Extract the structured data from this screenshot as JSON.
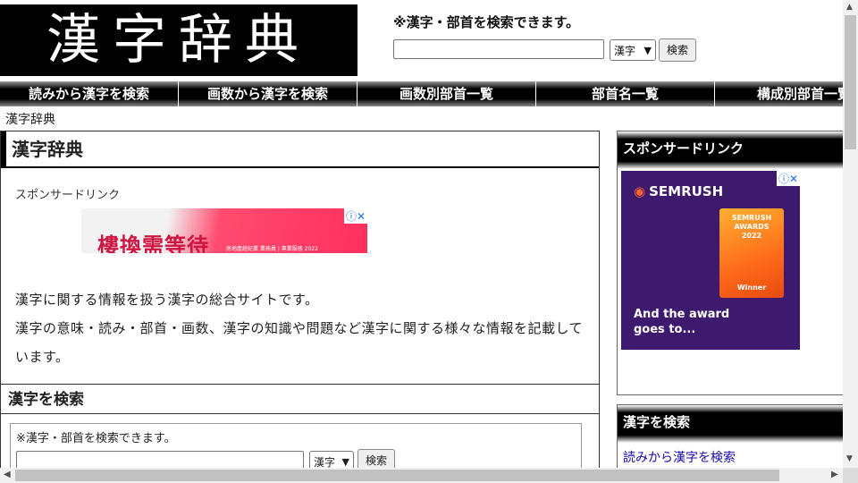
{
  "header": {
    "logo_text": "漢字辞典",
    "search_note": "※漢字・部首を検索できます。",
    "search_select": "漢字",
    "search_button": "検索"
  },
  "nav": {
    "items": [
      "読みから漢字を検索",
      "画数から漢字を検索",
      "画数別部首一覧",
      "部首名一覧",
      "構成別部首一覧"
    ]
  },
  "breadcrumb": "漢字辞典",
  "main": {
    "title": "漢字辞典",
    "sponsor_label": "スポンサードリンク",
    "ad": {
      "text": "樓換需等待",
      "fine_print": "房地產經紀業 業務員 | 專業服務 2022",
      "close_icon": "ⓘ✕"
    },
    "intro": [
      "漢字に関する情報を扱う漢字の総合サイトです。",
      "漢字の意味・読み・部首・画数、漢字の知識や問題など漢字に関する様々な情報を記載しています。"
    ],
    "search_section": {
      "title": "漢字を検索",
      "note": "※漢字・部首を検索できます。",
      "select": "漢字",
      "button": "検索"
    }
  },
  "sidebar": {
    "sponsor": {
      "title": "スポンサードリンク",
      "ad_brand": "SEMRUSH",
      "ad_award": "SEMRUSH AWARDS 2022",
      "ad_award_sub": "Winner",
      "ad_tagline_1": "And the award",
      "ad_tagline_2": "goes to...",
      "close_icon": "ⓘ✕"
    },
    "search": {
      "title": "漢字を検索",
      "link": "読みから漢字を検索"
    }
  },
  "colors": {
    "header_bg": "#000000",
    "nav_bg": "#000000",
    "link": "#1a0dab",
    "ad_purple": "#3d1a6e",
    "ad_orange": "#ff642d"
  }
}
